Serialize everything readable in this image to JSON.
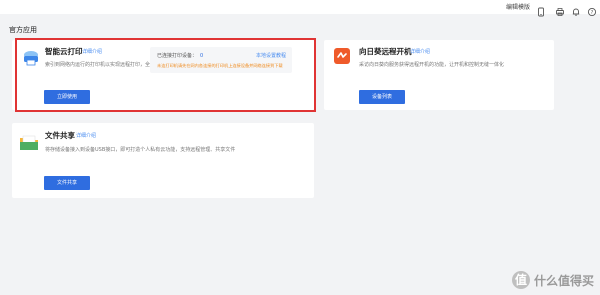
{
  "topbar": {
    "link_label": "编辑模版",
    "icons": [
      "phone-icon",
      "printer-icon",
      "bell-icon",
      "help-icon"
    ]
  },
  "section_title": "官方应用",
  "cards": {
    "cloud_print": {
      "name": "智能云打印",
      "detail_link": "详细介绍",
      "desc": "索引到网络内运行的打印机以实现远程打印，全面支持打印机",
      "button_label": "立即使用",
      "info": {
        "bound_label": "已连接打印设备：",
        "bound_count": "0",
        "setup_link": "本地设置教程",
        "warning": "未连打印机请先在网内各连接的打印机上连接设备并网络连接到下载"
      }
    },
    "remote_boot": {
      "name": "向日葵远程开机",
      "detail_link": "详细介绍",
      "desc": "采访向日葵向服务获得远程开机的功能，让开机和控制无缝一体化",
      "button_label": "设备列表"
    },
    "file_share": {
      "name": "文件共享",
      "detail_link": "详细介绍",
      "desc": "将存储设备接入到设备USB接口，即可打造个人私有云功能，支持远程管理、共享文件",
      "button_label": "文件共享"
    }
  },
  "watermark": {
    "logo": "值",
    "text": "什么值得买"
  },
  "colors": {
    "accent": "#2f6de0",
    "link": "#4a8df0",
    "highlight": "#e03434",
    "warning": "#ef8a1d"
  }
}
